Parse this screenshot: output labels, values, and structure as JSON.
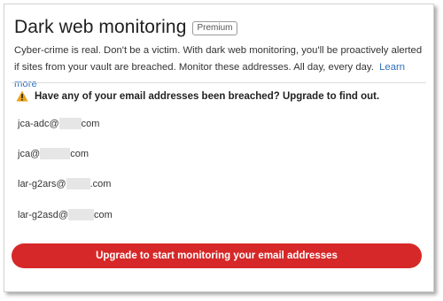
{
  "header": {
    "title": "Dark web monitoring",
    "badge": "Premium"
  },
  "description": {
    "text": "Cyber-crime is real. Don't be a victim. With dark web monitoring, you'll be proactively alerted if sites from your vault are breached. Monitor these addresses. All day, every day.",
    "link_label": "Learn more"
  },
  "warning": {
    "text": "Have any of your email addresses been breached? Upgrade to find out.",
    "icon": "warning-icon",
    "icon_color": "#e8a317"
  },
  "emails": [
    {
      "prefix": "jca-adc@",
      "suffix": "com"
    },
    {
      "prefix": "jca@",
      "suffix": "com"
    },
    {
      "prefix": "lar-g2ars@",
      "suffix": ".com"
    },
    {
      "prefix": "lar-g2asd@",
      "suffix": "com"
    }
  ],
  "cta": {
    "label": "Upgrade to start monitoring your email addresses",
    "color": "#d62828"
  }
}
